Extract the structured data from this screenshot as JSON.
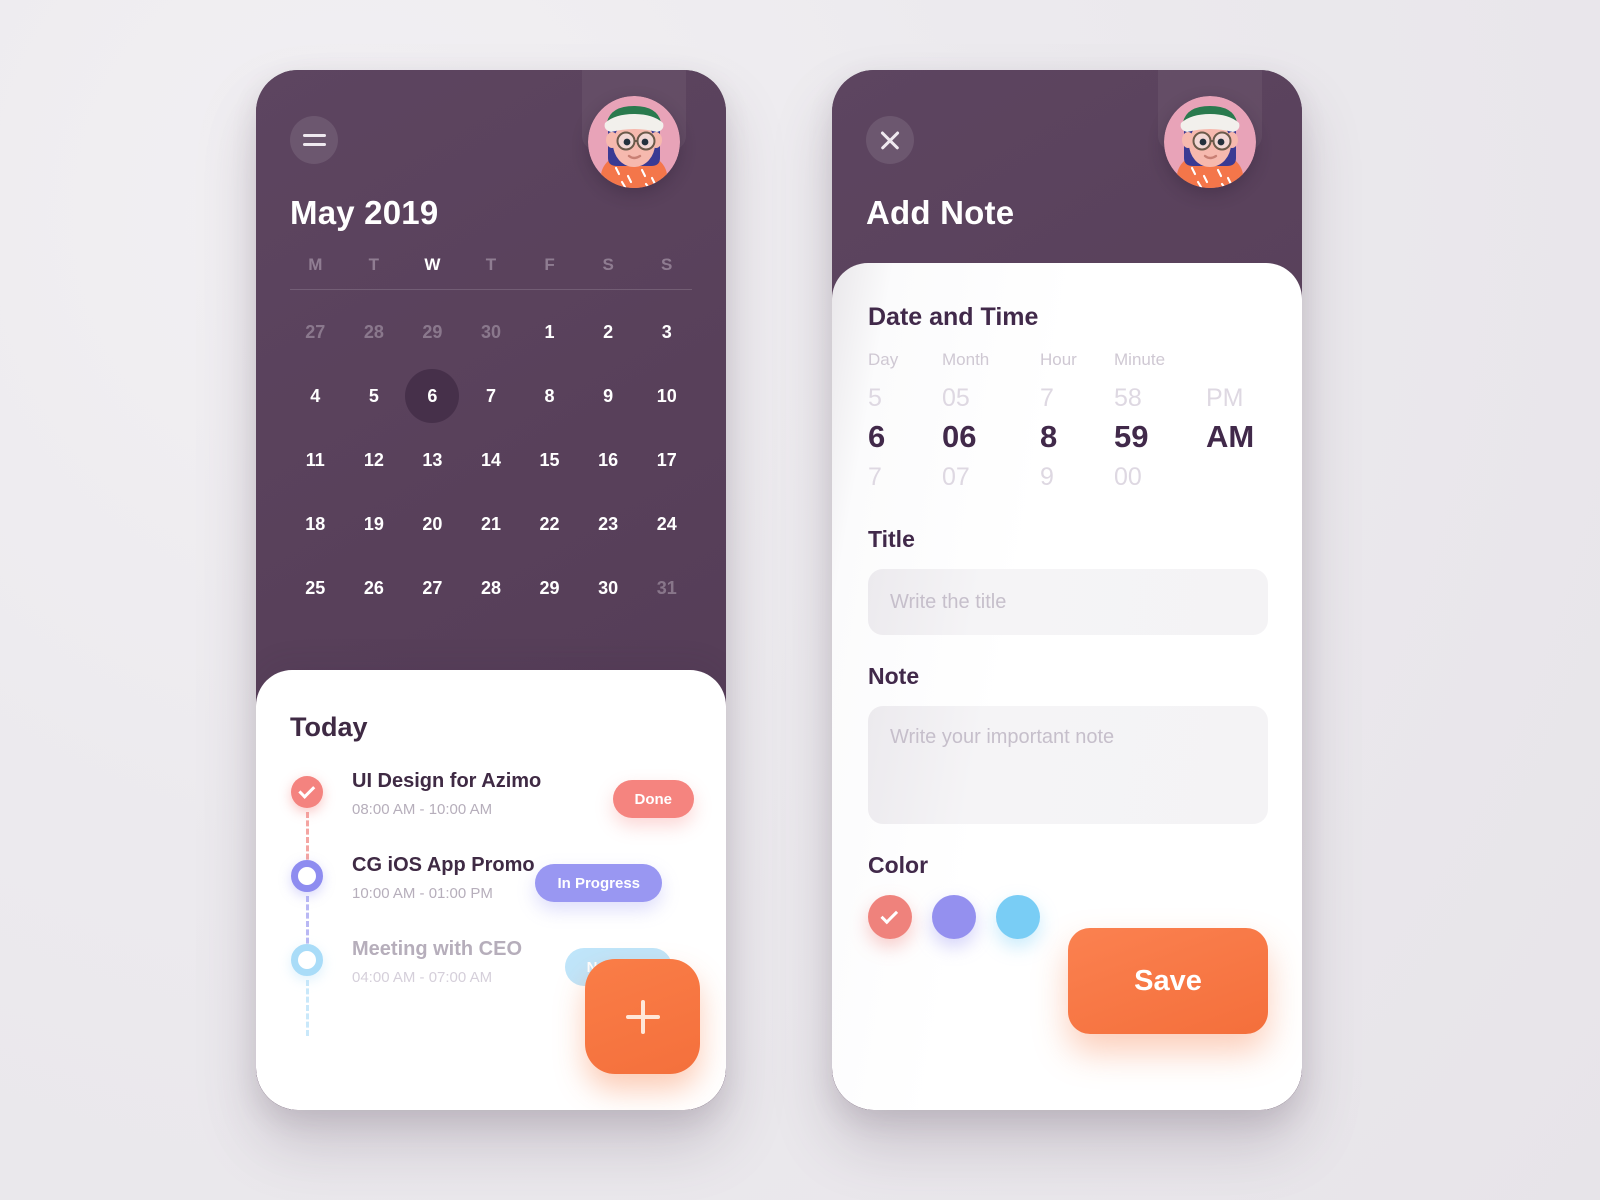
{
  "theme": {
    "bg": "#eceaee",
    "phone_purple": "#58405a",
    "accent_orange": "#f6783f",
    "coral": "#f5847f",
    "periwinkle": "#9997f2",
    "sky": "#bfe5fa",
    "dark_text": "#41294a"
  },
  "left_screen": {
    "menu_icon": "hamburger-icon",
    "avatar_alt": "user-avatar",
    "title": "May 2019",
    "weekdays": [
      {
        "label": "M",
        "active": false
      },
      {
        "label": "T",
        "active": false
      },
      {
        "label": "W",
        "active": true
      },
      {
        "label": "T",
        "active": false
      },
      {
        "label": "F",
        "active": false
      },
      {
        "label": "S",
        "active": false
      },
      {
        "label": "S",
        "active": false
      }
    ],
    "days": [
      {
        "n": "27",
        "muted": true
      },
      {
        "n": "28",
        "muted": true
      },
      {
        "n": "29",
        "muted": true
      },
      {
        "n": "30",
        "muted": true
      },
      {
        "n": "1",
        "muted": false
      },
      {
        "n": "2",
        "muted": false
      },
      {
        "n": "3",
        "muted": false
      },
      {
        "n": "4",
        "muted": false
      },
      {
        "n": "5",
        "muted": false
      },
      {
        "n": "6",
        "muted": false,
        "selected": true
      },
      {
        "n": "7",
        "muted": false
      },
      {
        "n": "8",
        "muted": false
      },
      {
        "n": "9",
        "muted": false
      },
      {
        "n": "10",
        "muted": false
      },
      {
        "n": "11",
        "muted": false
      },
      {
        "n": "12",
        "muted": false
      },
      {
        "n": "13",
        "muted": false
      },
      {
        "n": "14",
        "muted": false
      },
      {
        "n": "15",
        "muted": false
      },
      {
        "n": "16",
        "muted": false
      },
      {
        "n": "17",
        "muted": false
      },
      {
        "n": "18",
        "muted": false
      },
      {
        "n": "19",
        "muted": false
      },
      {
        "n": "20",
        "muted": false
      },
      {
        "n": "21",
        "muted": false
      },
      {
        "n": "22",
        "muted": false
      },
      {
        "n": "23",
        "muted": false
      },
      {
        "n": "24",
        "muted": false
      },
      {
        "n": "25",
        "muted": false
      },
      {
        "n": "26",
        "muted": false
      },
      {
        "n": "27",
        "muted": false
      },
      {
        "n": "28",
        "muted": false
      },
      {
        "n": "29",
        "muted": false
      },
      {
        "n": "30",
        "muted": false
      },
      {
        "n": "31",
        "muted": true
      }
    ],
    "today_heading": "Today",
    "tasks": [
      {
        "title": "UI Design for Azimo",
        "time": "08:00 AM - 10:00 AM",
        "status": "Done",
        "state": "done"
      },
      {
        "title": "CG iOS App Promo",
        "time": "10:00 AM - 01:00 PM",
        "status": "In Progress",
        "state": "progress"
      },
      {
        "title": "Meeting with CEO",
        "time": "04:00 AM - 07:00 AM",
        "status": "Not Start",
        "state": "notstart"
      }
    ],
    "fab_icon": "plus-icon"
  },
  "right_screen": {
    "close_icon": "close-icon",
    "avatar_alt": "user-avatar",
    "title": "Add Note",
    "datetime": {
      "heading": "Date and Time",
      "labels": [
        "Day",
        "Month",
        "Hour",
        "Minute"
      ],
      "prev": [
        "5",
        "05",
        "7",
        "58",
        "PM"
      ],
      "current": [
        "6",
        "06",
        "8",
        "59",
        "AM"
      ],
      "next": [
        "7",
        "07",
        "9",
        "00",
        ""
      ]
    },
    "title_field": {
      "label": "Title",
      "value": "",
      "placeholder": "Write the title"
    },
    "note_field": {
      "label": "Note",
      "value": "",
      "placeholder": "Write your important note"
    },
    "color": {
      "label": "Color",
      "options": [
        {
          "hex": "#ef827c",
          "selected": true
        },
        {
          "hex": "#9490ef",
          "selected": false
        },
        {
          "hex": "#79cdf5",
          "selected": false
        }
      ]
    },
    "save_label": "Save"
  }
}
